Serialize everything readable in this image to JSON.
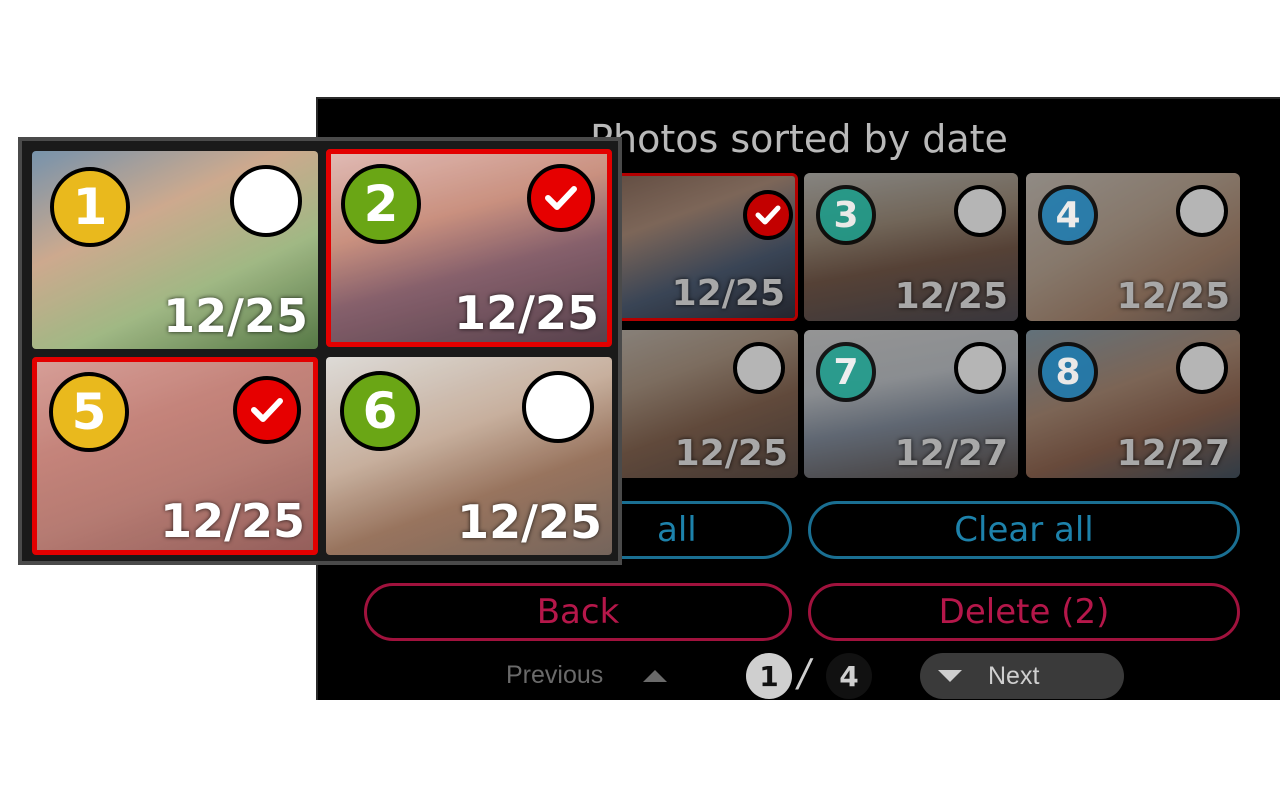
{
  "screen": {
    "title": "Photos sorted by date",
    "tiles": [
      {
        "number": "2",
        "date": "12/25",
        "badge_color": "#6aa615",
        "selected": true
      },
      {
        "number": "3",
        "date": "12/25",
        "badge_color": "#1a9e8c",
        "selected": false
      },
      {
        "number": "4",
        "date": "12/25",
        "badge_color": "#1b7cb3",
        "selected": false
      },
      {
        "number": "6",
        "date": "12/25",
        "badge_color": "#6aa615",
        "selected": false
      },
      {
        "number": "7",
        "date": "12/27",
        "badge_color": "#1a9e8c",
        "selected": false
      },
      {
        "number": "8",
        "date": "12/27",
        "badge_color": "#1b7cb3",
        "selected": false
      }
    ],
    "buttons": {
      "select_all_visible": "all",
      "clear_all": "Clear all",
      "back": "Back",
      "delete": "Delete (2)"
    },
    "pager": {
      "previous": "Previous",
      "current_page": "1",
      "separator": "/",
      "total_pages": "4",
      "next": "Next"
    }
  },
  "zoom": {
    "tiles": [
      {
        "number": "1",
        "date": "12/25",
        "badge_color": "#e9b91d",
        "selected": false
      },
      {
        "number": "2",
        "date": "12/25",
        "badge_color": "#6aa615",
        "selected": true
      },
      {
        "number": "5",
        "date": "12/25",
        "badge_color": "#e9b91d",
        "selected": true
      },
      {
        "number": "6",
        "date": "12/25",
        "badge_color": "#6aa615",
        "selected": false
      }
    ]
  },
  "colors": {
    "selected_check": "#e60000",
    "unselected_check_screen": "#b5b5b5",
    "unselected_check_zoom": "#ffffff",
    "accent_blue": "#1d82ab",
    "accent_red": "#b5174a"
  },
  "icons": {
    "check": "checkmark-icon",
    "previous": "triangle-up-icon",
    "next": "triangle-down-icon"
  }
}
